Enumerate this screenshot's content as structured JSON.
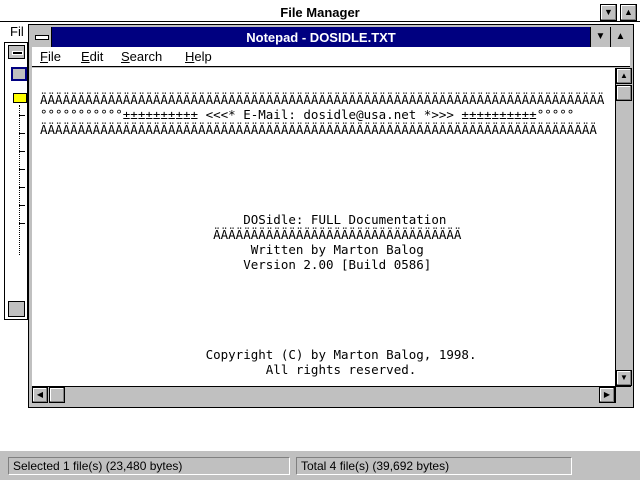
{
  "file_manager": {
    "title": "File Manager",
    "menu": {
      "file_label": "Fil"
    },
    "status": {
      "selected": "Selected 1 file(s) (23,480 bytes)",
      "total": "Total 4 file(s) (39,692 bytes)"
    }
  },
  "notepad": {
    "title": "Notepad - DOSIDLE.TXT",
    "menu": [
      {
        "label": "File",
        "key": "F",
        "rest": "ile"
      },
      {
        "label": "Edit",
        "key": "E",
        "rest": "dit"
      },
      {
        "label": "Search",
        "key": "S",
        "rest": "earch"
      },
      {
        "label": "Help",
        "key": "H",
        "rest": "elp"
      }
    ],
    "lines": [
      "ÄÄÄÄÄÄÄÄÄÄÄÄÄÄÄÄÄÄÄÄÄÄÄÄÄÄÄÄÄÄÄÄÄÄÄÄÄÄÄÄÄÄÄÄÄÄÄÄÄÄÄÄÄÄÄÄÄÄÄÄÄÄÄÄÄÄÄÄÄÄÄÄÄÄÄ",
      "°°°°°°°°°°°±±±±±±±±±± <<<* E-Mail: dosidle@usa.net *>>> ±±±±±±±±±±°°°°°",
      "ÄÄÄÄÄÄÄÄÄÄÄÄÄÄÄÄÄÄÄÄÄÄÄÄÄÄÄÄÄÄÄÄÄÄÄÄÄÄÄÄÄÄÄÄÄÄÄÄÄÄÄÄÄÄÄÄÄÄÄÄÄÄÄÄÄÄÄÄÄÄÄÄÄÄ",
      "",
      "",
      "",
      "",
      "",
      "                           DOSidle: FULL Documentation",
      "                       ÄÄÄÄÄÄÄÄÄÄÄÄÄÄÄÄÄÄÄÄÄÄÄÄÄÄÄÄÄÄÄÄÄ",
      "                            Written by Marton Balog",
      "                           Version 2.00 [Build 0586]",
      "",
      "",
      "",
      "",
      "",
      "                      Copyright (C) by Marton Balog, 1998.",
      "                              All rights reserved."
    ]
  }
}
